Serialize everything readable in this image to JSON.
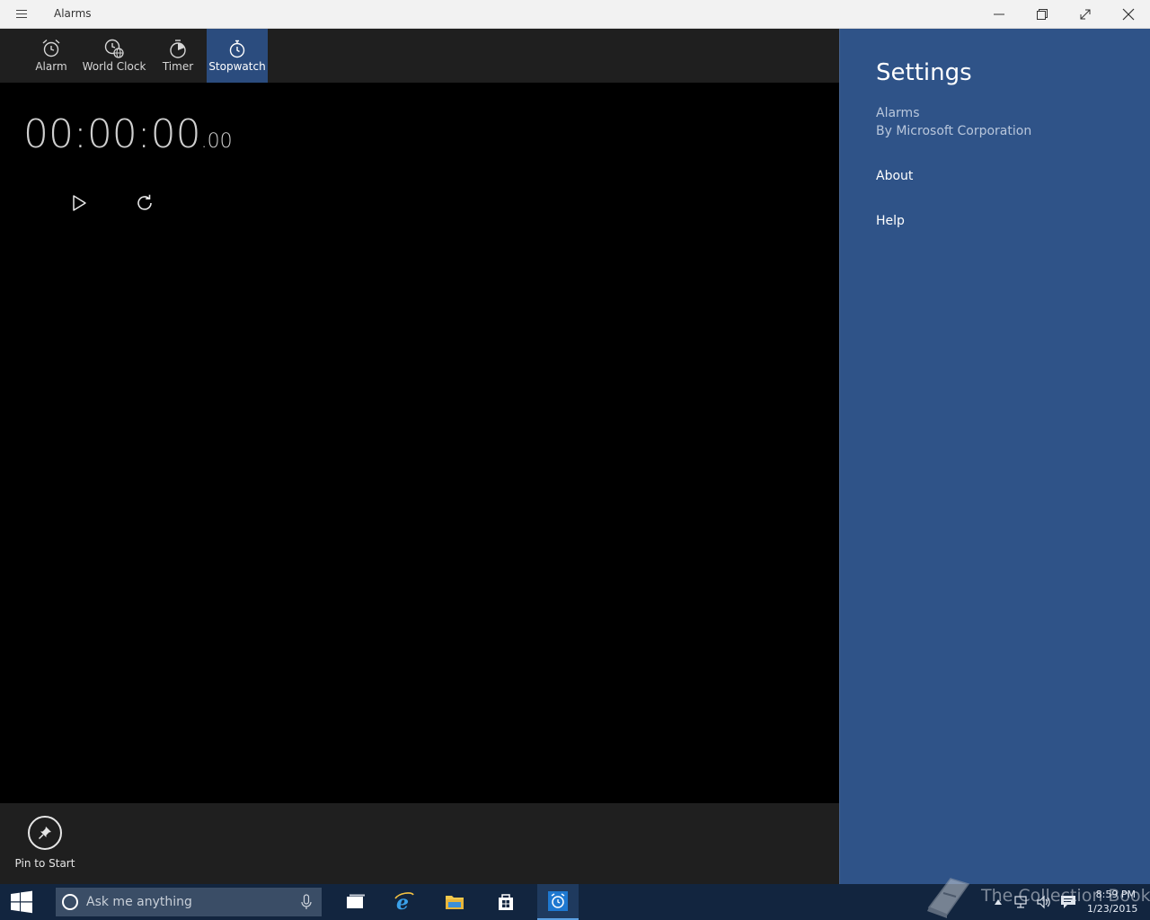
{
  "window": {
    "title": "Alarms"
  },
  "tabs": [
    {
      "label": "Alarm",
      "icon": "alarm-clock-icon"
    },
    {
      "label": "World Clock",
      "icon": "world-clock-icon"
    },
    {
      "label": "Timer",
      "icon": "timer-icon"
    },
    {
      "label": "Stopwatch",
      "icon": "stopwatch-icon",
      "active": true
    }
  ],
  "stopwatch": {
    "time": "00:00:00",
    "fraction": ".00"
  },
  "bottom_bar": {
    "pin_label": "Pin to Start"
  },
  "settings": {
    "title": "Settings",
    "app_name": "Alarms",
    "publisher": "By Microsoft Corporation",
    "links": [
      "About",
      "Help"
    ],
    "background": "#2f5388"
  },
  "taskbar": {
    "search_placeholder": "Ask me anything",
    "time": "8:59 PM",
    "date": "1/23/2015"
  },
  "watermark": "The Collection Book",
  "colors": {
    "active_tab": "#2b4c7e",
    "taskbar": "#12253f"
  }
}
